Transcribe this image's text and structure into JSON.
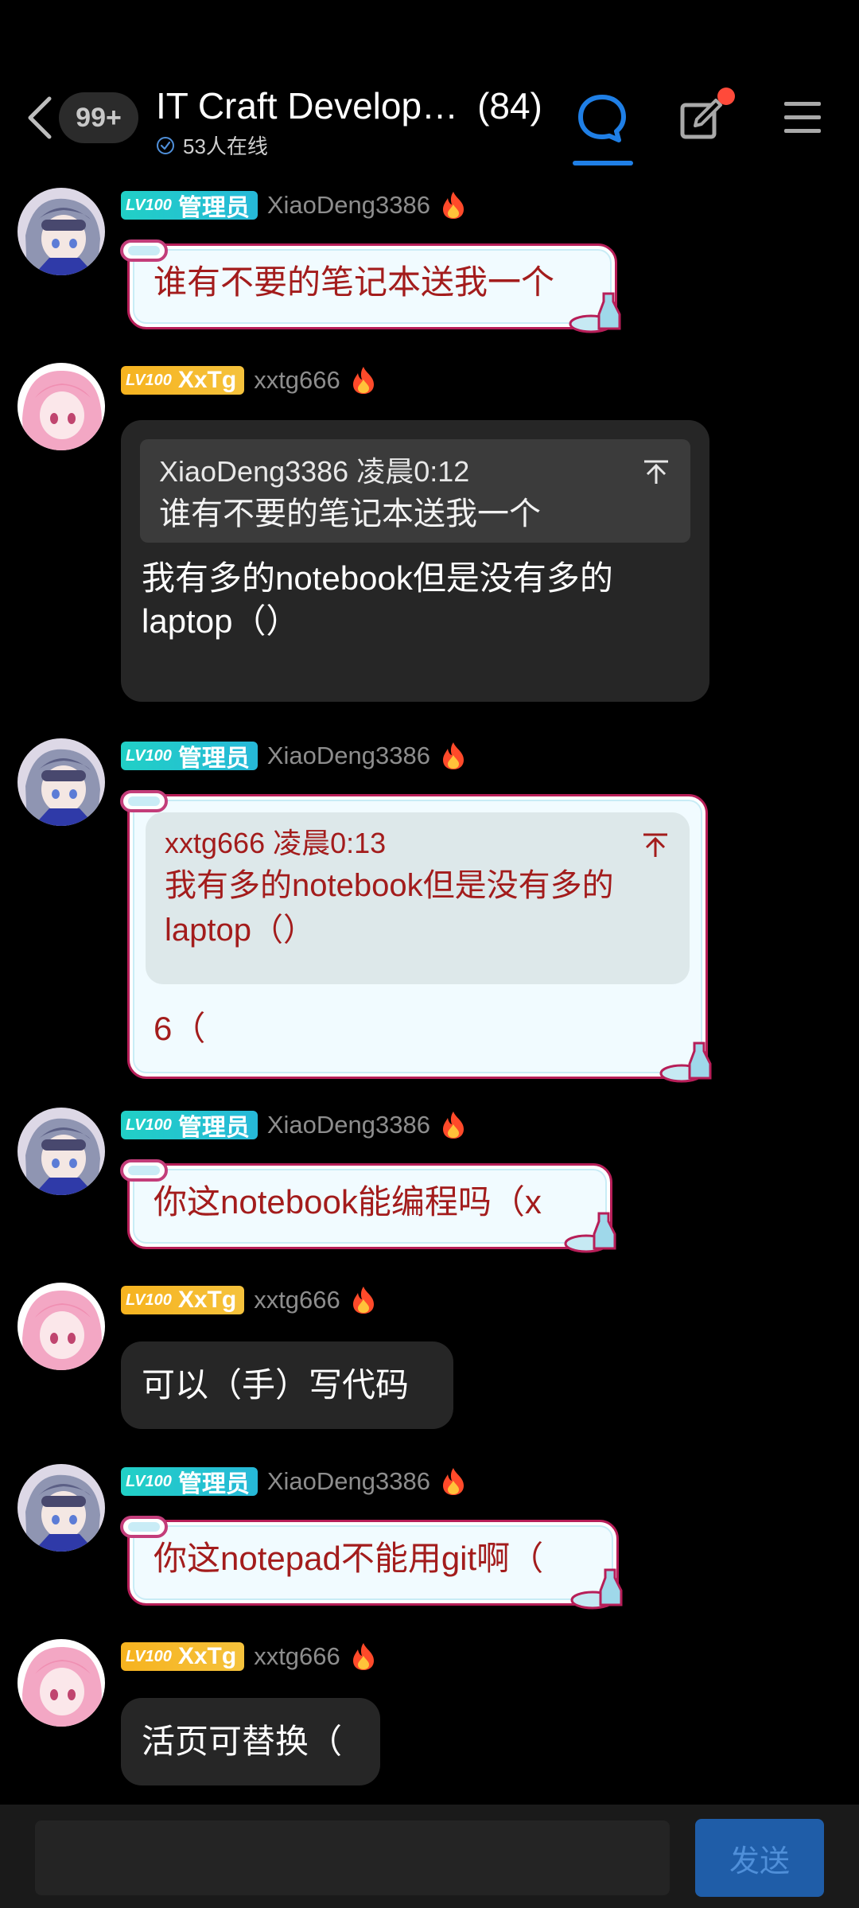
{
  "header": {
    "unread_count": "99+",
    "title": "IT Craft Develop…",
    "member_count": "(84)",
    "online_text": "53人在线"
  },
  "colors": {
    "admin_tag": "#21d0c6",
    "xxtg_tag": "#f6b31f",
    "accent_blue": "#1f7fe6",
    "deco_text": "#a31c1c"
  },
  "messages": [
    {
      "level": "LV100",
      "role": "管理员",
      "username": "XiaoDeng3386",
      "text": "谁有不要的笔记本送我一个"
    },
    {
      "level": "LV100",
      "role": "XxTg",
      "username": "xxtg666",
      "quote_author": "XiaoDeng3386 凌晨0:12",
      "quote_text": "谁有不要的笔记本送我一个",
      "text": "我有多的notebook但是没有多的laptop（）"
    },
    {
      "level": "LV100",
      "role": "管理员",
      "username": "XiaoDeng3386",
      "quote_author": "xxtg666 凌晨0:13",
      "quote_text": "我有多的notebook但是没有多的laptop（）",
      "text": "6（"
    },
    {
      "level": "LV100",
      "role": "管理员",
      "username": "XiaoDeng3386",
      "text": "你这notebook能编程吗（x"
    },
    {
      "level": "LV100",
      "role": "XxTg",
      "username": "xxtg666",
      "text": "可以（手）写代码"
    },
    {
      "level": "LV100",
      "role": "管理员",
      "username": "XiaoDeng3386",
      "text": "你这notepad不能用git啊（"
    },
    {
      "level": "LV100",
      "role": "XxTg",
      "username": "xxtg666",
      "text": "活页可替换（"
    }
  ],
  "composer": {
    "placeholder": "",
    "send_label": "发送"
  }
}
